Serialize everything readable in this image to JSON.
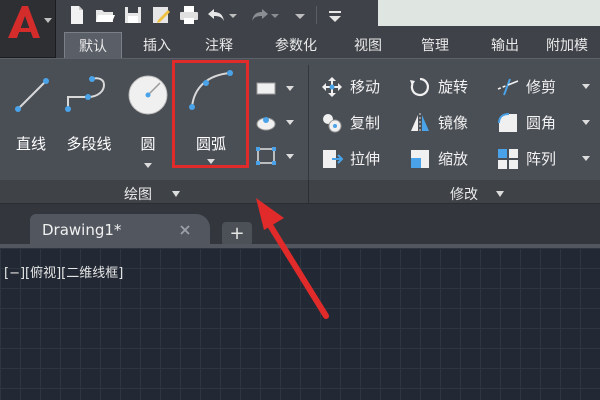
{
  "ribbon_tabs": [
    "默认",
    "插入",
    "注释",
    "参数化",
    "视图",
    "管理",
    "输出",
    "附加模"
  ],
  "draw_panel": {
    "title": "绘图",
    "tools": {
      "line": "直线",
      "polyline": "多段线",
      "circle": "圆",
      "arc": "圆弧"
    }
  },
  "modify_panel": {
    "title": "修改",
    "tools": {
      "move": "移动",
      "rotate": "旋转",
      "trim": "修剪",
      "copy": "复制",
      "mirror": "镜像",
      "fillet": "圆角",
      "stretch": "拉伸",
      "scale": "缩放",
      "array": "阵列"
    }
  },
  "document": {
    "tab_label": "Drawing1*",
    "new_tab_symbol": "+"
  },
  "viewport_label": "[−][俯视][二维线框]",
  "colors": {
    "accent_red": "#e12a2a",
    "ribbon_bg": "#4a4e55",
    "canvas_bg": "#222934"
  }
}
